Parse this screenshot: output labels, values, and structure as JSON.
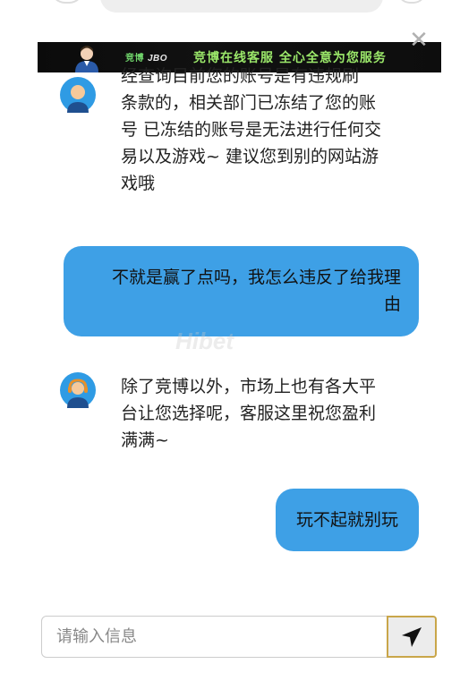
{
  "banner": {
    "logo_text": "竞博",
    "logo_brand": "JBO",
    "slogan": "竞博在线客服  全心全意为您服务",
    "close_label": "✕"
  },
  "chat": {
    "messages": [
      {
        "from": "agent",
        "text_partial_top": "经查询目前您的账号是有违规刷条款的，相关部门已冻结了您的账号 已冻结的账号是无法进行任何交易以及游戏~ 建议您到别的网站游戏哦",
        "lines": [
          "条款的，相关部门已冻结了您的账",
          "号 已冻结的账号是无法进行任何交",
          "易以及游戏~ 建议您到别的网站游",
          "戏哦"
        ]
      },
      {
        "from": "user",
        "lines": [
          "不就是赢了点吗，我怎么违反了给我理",
          "由"
        ]
      },
      {
        "from": "agent",
        "lines": [
          "除了竞博以外，市场上也有各大平",
          "台让您选择呢，客服这里祝您盈利",
          "满满~"
        ]
      },
      {
        "from": "user",
        "lines": [
          "玩不起就别玩"
        ]
      }
    ]
  },
  "watermark": "Hibet",
  "input": {
    "placeholder": "请输入信息",
    "value": ""
  },
  "colors": {
    "user_bubble": "#3ea0e6",
    "avatar_bg": "#2f9be4",
    "send_border": "#c9a64a"
  },
  "icons": {
    "agent_avatar": "headset-agent-icon",
    "send": "send-arrow-icon",
    "close": "close-icon"
  }
}
